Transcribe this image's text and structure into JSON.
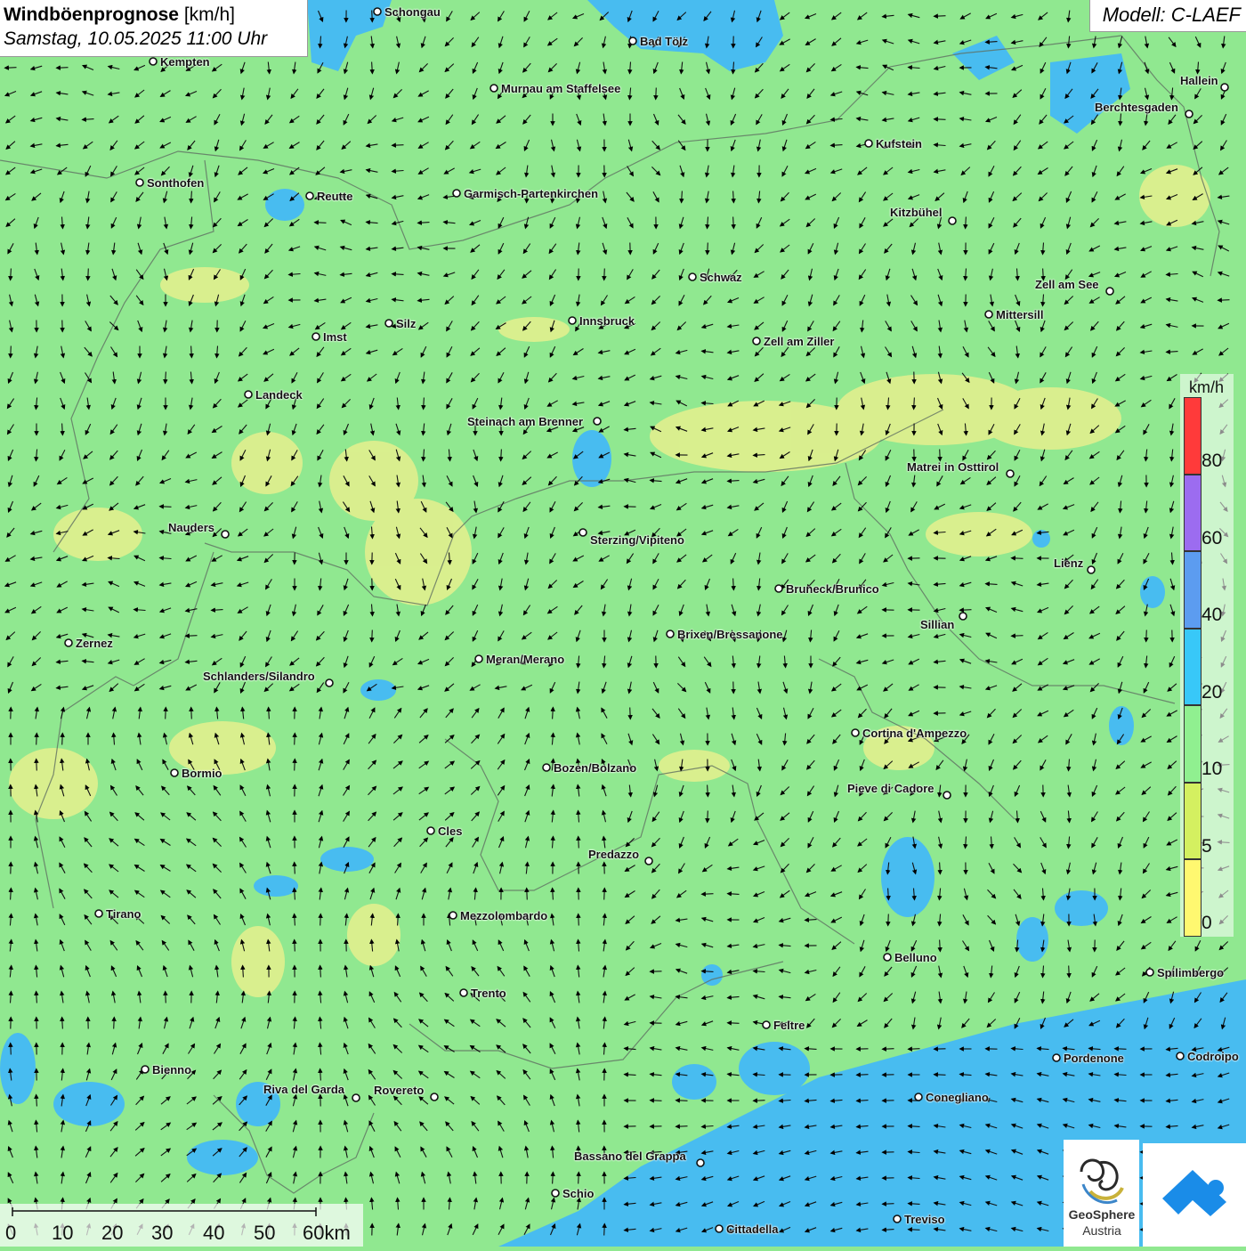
{
  "header": {
    "title": "Windböenprognose",
    "unit": "[km/h]",
    "datetime": "Samstag, 10.05.2025 11:00 Uhr",
    "model": "Modell: C-LAEF"
  },
  "colors": {
    "base": "#90e890",
    "yellow_zone": "#e8f08a",
    "blue_zone": "#4cc0f0",
    "border": "#6a7a6a"
  },
  "legend": {
    "unit": "km/h",
    "bands": [
      {
        "label": "80",
        "color": "#ff3a3a"
      },
      {
        "label": "60",
        "color": "#9c6cf0"
      },
      {
        "label": "40",
        "color": "#5c9cf0"
      },
      {
        "label": "20",
        "color": "#38c8f8"
      },
      {
        "label": "10",
        "color": "#90f090"
      },
      {
        "label": "5",
        "color": "#d4f060"
      },
      {
        "label": "0",
        "color": "#fff870"
      }
    ]
  },
  "scalebar": {
    "labels": [
      "0",
      "10",
      "20",
      "30",
      "40",
      "50",
      "60km"
    ]
  },
  "logo": {
    "name_line1": "GeoSphere",
    "name_line2": "Austria"
  },
  "cities": [
    {
      "name": "Schongau"
    },
    {
      "name": "Bad Tölz"
    },
    {
      "name": "Kempten"
    },
    {
      "name": "Murnau am Staffelsee"
    },
    {
      "name": "Hallein"
    },
    {
      "name": "Berchtesgaden"
    },
    {
      "name": "Kufstein"
    },
    {
      "name": "Sonthofen"
    },
    {
      "name": "Reutte"
    },
    {
      "name": "Garmisch-Partenkirchen"
    },
    {
      "name": "Kitzbühel"
    },
    {
      "name": "Schwaz"
    },
    {
      "name": "Zell am See"
    },
    {
      "name": "Mittersill"
    },
    {
      "name": "Innsbruck"
    },
    {
      "name": "Silz"
    },
    {
      "name": "Imst"
    },
    {
      "name": "Zell am Ziller"
    },
    {
      "name": "Landeck"
    },
    {
      "name": "Steinach am Brenner"
    },
    {
      "name": "Matrei in Osttirol"
    },
    {
      "name": "Nauders"
    },
    {
      "name": "Sterzing/Vipiteno"
    },
    {
      "name": "Lienz"
    },
    {
      "name": "Bruneck/Brunico"
    },
    {
      "name": "Sillian"
    },
    {
      "name": "Brixen/Bressanone"
    },
    {
      "name": "Zernez"
    },
    {
      "name": "Meran/Merano"
    },
    {
      "name": "Schlanders/Silandro"
    },
    {
      "name": "Cortina d'Ampezzo"
    },
    {
      "name": "Bozen/Bolzano"
    },
    {
      "name": "Bormio"
    },
    {
      "name": "Pieve di Cadore"
    },
    {
      "name": "Cles"
    },
    {
      "name": "Predazzo"
    },
    {
      "name": "Tirano"
    },
    {
      "name": "Mezzolombardo"
    },
    {
      "name": "Belluno"
    },
    {
      "name": "Spilimbergo"
    },
    {
      "name": "Trento"
    },
    {
      "name": "Feltre"
    },
    {
      "name": "Pordenone"
    },
    {
      "name": "Codroipo"
    },
    {
      "name": "Bienno"
    },
    {
      "name": "Riva del Garda"
    },
    {
      "name": "Rovereto"
    },
    {
      "name": "Conegliano"
    },
    {
      "name": "Bassano del Grappa"
    },
    {
      "name": "Schio"
    },
    {
      "name": "Treviso"
    },
    {
      "name": "Cittadella"
    }
  ]
}
